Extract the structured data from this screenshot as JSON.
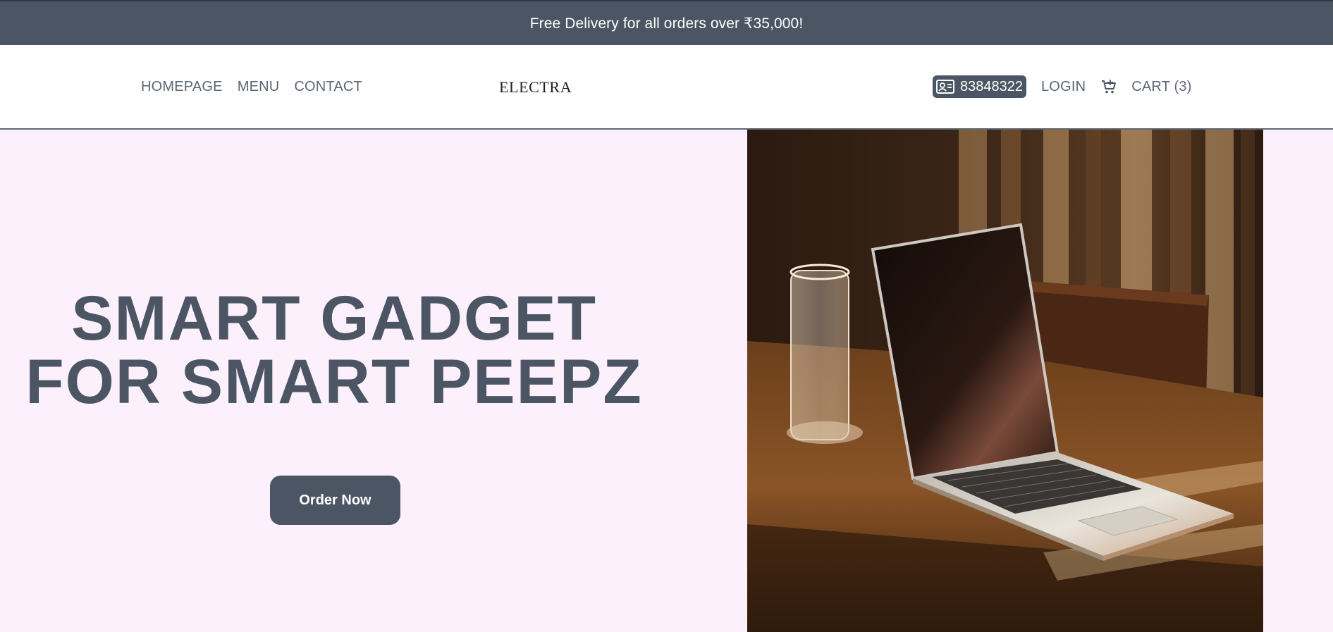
{
  "promo": {
    "text": "Free Delivery for all orders over ₹35,000!"
  },
  "nav": {
    "left": [
      "HOMEPAGE",
      "MENU",
      "CONTACT"
    ],
    "logo": "ELECTRA",
    "phone": "83848322",
    "login": "LOGIN",
    "cart": "CART (3)"
  },
  "hero": {
    "title_line1": "SMART GADGET",
    "title_line2": "FOR SMART PEEPZ",
    "button": "Order Now",
    "image_subject": "laptop on wooden table with glass"
  },
  "colors": {
    "accent": "#4b5563",
    "background": "#fdf0fd",
    "header_bg": "#ffffff"
  },
  "icons": [
    "contact-card-icon",
    "cart-icon"
  ]
}
